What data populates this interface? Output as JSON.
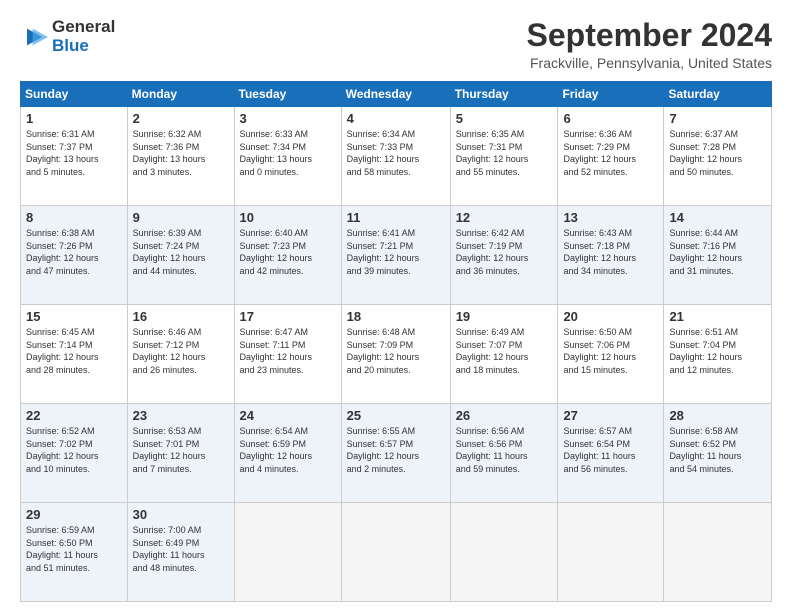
{
  "logo": {
    "line1": "General",
    "line2": "Blue",
    "icon": "▶"
  },
  "header": {
    "month": "September 2024",
    "location": "Frackville, Pennsylvania, United States"
  },
  "weekdays": [
    "Sunday",
    "Monday",
    "Tuesday",
    "Wednesday",
    "Thursday",
    "Friday",
    "Saturday"
  ],
  "weeks": [
    [
      {
        "day": "1",
        "sunrise": "6:31 AM",
        "sunset": "7:37 PM",
        "daylight": "13 hours and 5 minutes."
      },
      {
        "day": "2",
        "sunrise": "6:32 AM",
        "sunset": "7:36 PM",
        "daylight": "13 hours and 3 minutes."
      },
      {
        "day": "3",
        "sunrise": "6:33 AM",
        "sunset": "7:34 PM",
        "daylight": "13 hours and 0 minutes."
      },
      {
        "day": "4",
        "sunrise": "6:34 AM",
        "sunset": "7:33 PM",
        "daylight": "12 hours and 58 minutes."
      },
      {
        "day": "5",
        "sunrise": "6:35 AM",
        "sunset": "7:31 PM",
        "daylight": "12 hours and 55 minutes."
      },
      {
        "day": "6",
        "sunrise": "6:36 AM",
        "sunset": "7:29 PM",
        "daylight": "12 hours and 52 minutes."
      },
      {
        "day": "7",
        "sunrise": "6:37 AM",
        "sunset": "7:28 PM",
        "daylight": "12 hours and 50 minutes."
      }
    ],
    [
      {
        "day": "8",
        "sunrise": "6:38 AM",
        "sunset": "7:26 PM",
        "daylight": "12 hours and 47 minutes."
      },
      {
        "day": "9",
        "sunrise": "6:39 AM",
        "sunset": "7:24 PM",
        "daylight": "12 hours and 44 minutes."
      },
      {
        "day": "10",
        "sunrise": "6:40 AM",
        "sunset": "7:23 PM",
        "daylight": "12 hours and 42 minutes."
      },
      {
        "day": "11",
        "sunrise": "6:41 AM",
        "sunset": "7:21 PM",
        "daylight": "12 hours and 39 minutes."
      },
      {
        "day": "12",
        "sunrise": "6:42 AM",
        "sunset": "7:19 PM",
        "daylight": "12 hours and 36 minutes."
      },
      {
        "day": "13",
        "sunrise": "6:43 AM",
        "sunset": "7:18 PM",
        "daylight": "12 hours and 34 minutes."
      },
      {
        "day": "14",
        "sunrise": "6:44 AM",
        "sunset": "7:16 PM",
        "daylight": "12 hours and 31 minutes."
      }
    ],
    [
      {
        "day": "15",
        "sunrise": "6:45 AM",
        "sunset": "7:14 PM",
        "daylight": "12 hours and 28 minutes."
      },
      {
        "day": "16",
        "sunrise": "6:46 AM",
        "sunset": "7:12 PM",
        "daylight": "12 hours and 26 minutes."
      },
      {
        "day": "17",
        "sunrise": "6:47 AM",
        "sunset": "7:11 PM",
        "daylight": "12 hours and 23 minutes."
      },
      {
        "day": "18",
        "sunrise": "6:48 AM",
        "sunset": "7:09 PM",
        "daylight": "12 hours and 20 minutes."
      },
      {
        "day": "19",
        "sunrise": "6:49 AM",
        "sunset": "7:07 PM",
        "daylight": "12 hours and 18 minutes."
      },
      {
        "day": "20",
        "sunrise": "6:50 AM",
        "sunset": "7:06 PM",
        "daylight": "12 hours and 15 minutes."
      },
      {
        "day": "21",
        "sunrise": "6:51 AM",
        "sunset": "7:04 PM",
        "daylight": "12 hours and 12 minutes."
      }
    ],
    [
      {
        "day": "22",
        "sunrise": "6:52 AM",
        "sunset": "7:02 PM",
        "daylight": "12 hours and 10 minutes."
      },
      {
        "day": "23",
        "sunrise": "6:53 AM",
        "sunset": "7:01 PM",
        "daylight": "12 hours and 7 minutes."
      },
      {
        "day": "24",
        "sunrise": "6:54 AM",
        "sunset": "6:59 PM",
        "daylight": "12 hours and 4 minutes."
      },
      {
        "day": "25",
        "sunrise": "6:55 AM",
        "sunset": "6:57 PM",
        "daylight": "12 hours and 2 minutes."
      },
      {
        "day": "26",
        "sunrise": "6:56 AM",
        "sunset": "6:56 PM",
        "daylight": "11 hours and 59 minutes."
      },
      {
        "day": "27",
        "sunrise": "6:57 AM",
        "sunset": "6:54 PM",
        "daylight": "11 hours and 56 minutes."
      },
      {
        "day": "28",
        "sunrise": "6:58 AM",
        "sunset": "6:52 PM",
        "daylight": "11 hours and 54 minutes."
      }
    ],
    [
      {
        "day": "29",
        "sunrise": "6:59 AM",
        "sunset": "6:50 PM",
        "daylight": "11 hours and 51 minutes."
      },
      {
        "day": "30",
        "sunrise": "7:00 AM",
        "sunset": "6:49 PM",
        "daylight": "11 hours and 48 minutes."
      },
      null,
      null,
      null,
      null,
      null
    ]
  ]
}
